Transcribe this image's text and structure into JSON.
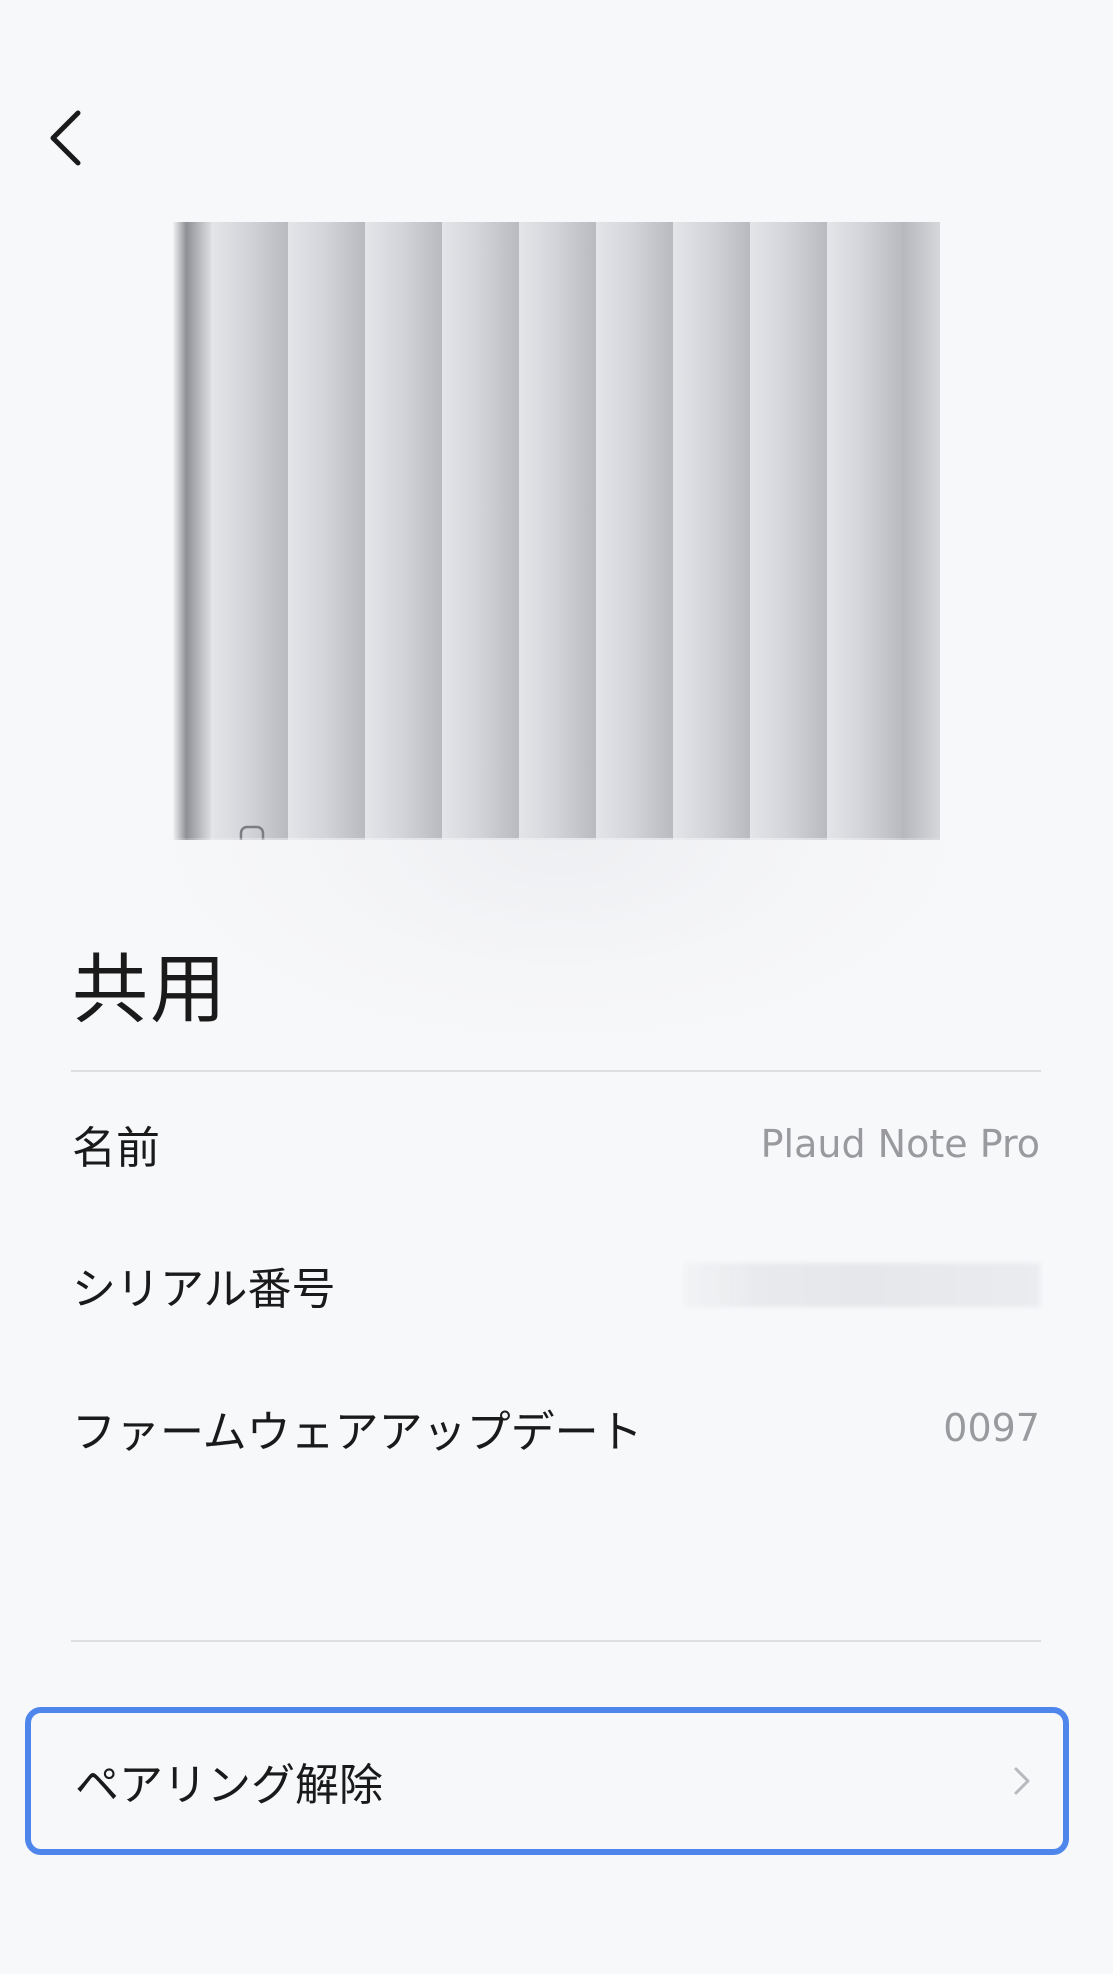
{
  "header": {
    "back_icon": "chevron-left-icon"
  },
  "device": {
    "image": "device-photo"
  },
  "section": {
    "title": "共用"
  },
  "info_rows": [
    {
      "label": "名前",
      "value": "Plaud Note Pro"
    },
    {
      "label": "シリアル番号",
      "value": ""
    },
    {
      "label": "ファームウェアアップデート",
      "value": "0097"
    }
  ],
  "actions": {
    "unpair_label": "ペアリング解除",
    "chevron_icon": "chevron-right-icon"
  },
  "colors": {
    "background": "#f7f8fa",
    "highlight_border": "#4f86ec",
    "text_primary": "#1a1a1a",
    "text_secondary": "#9a9a9e",
    "divider": "#dedfe2"
  }
}
